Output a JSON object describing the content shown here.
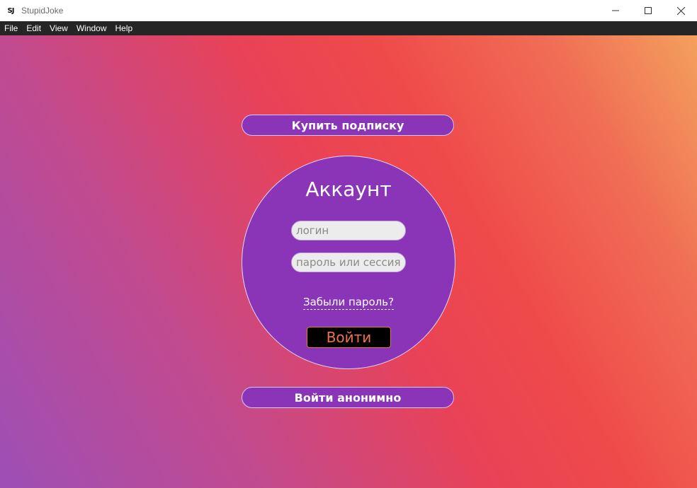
{
  "window": {
    "title": "StupidJoke",
    "logo_text": "SJ",
    "controls": {
      "minimize_icon": "minimize-icon",
      "maximize_icon": "maximize-icon",
      "close_icon": "close-icon"
    }
  },
  "menubar": {
    "items": [
      "File",
      "Edit",
      "View",
      "Window",
      "Help"
    ]
  },
  "content": {
    "subscribe_button": "Купить подписку",
    "account": {
      "title": "Аккаунт",
      "login_placeholder": "логин",
      "password_placeholder": "пароль или сессия",
      "forgot_link": "Забыли пароль?",
      "login_button": "Войти"
    },
    "anon_button": "Войти анонимно"
  },
  "colors": {
    "accent_purple": "#8a35b8",
    "menubar_bg": "#252525",
    "login_text": "#ef7248"
  }
}
